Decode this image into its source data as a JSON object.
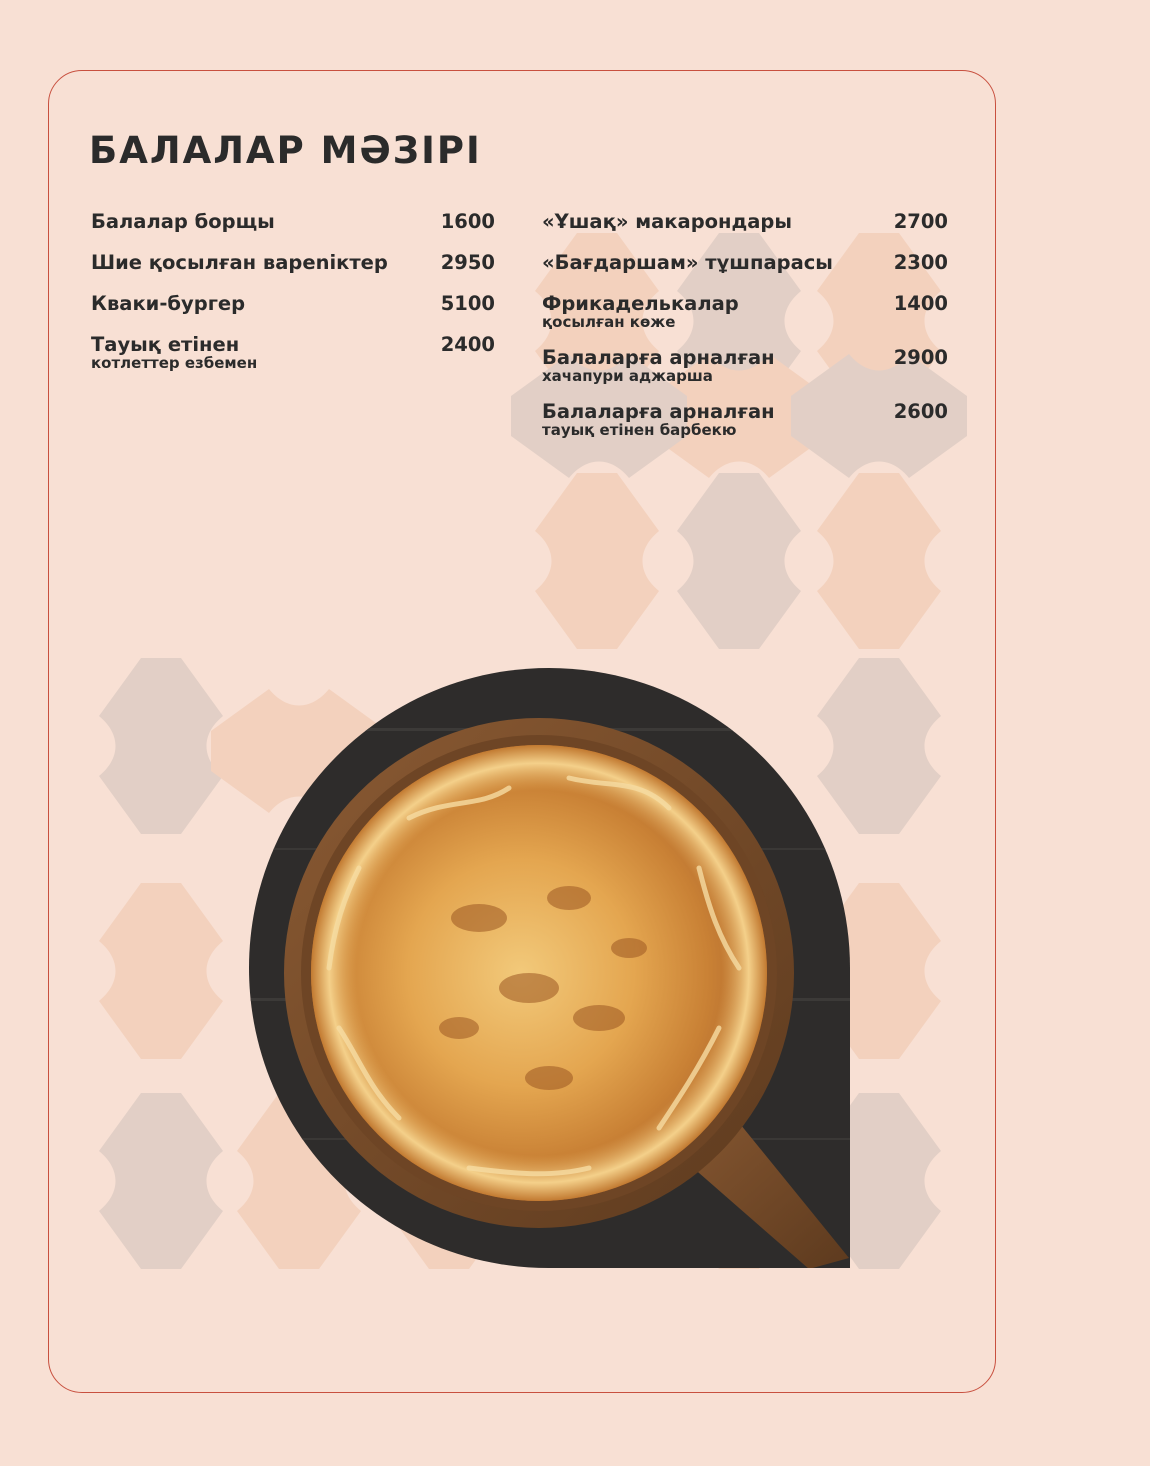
{
  "menu": {
    "title": "БАЛАЛАР МӘЗІРІ",
    "left_items": [
      {
        "name": "Балалар борщы",
        "sub": "",
        "price": "1600"
      },
      {
        "name": "Шие қосылған вареniктер",
        "sub": "",
        "price": "2950"
      },
      {
        "name": "Кваки-бургер",
        "sub": "",
        "price": "5100"
      },
      {
        "name": "Тауық етінен",
        "sub": "котлеттер езбемен",
        "price": "2400"
      }
    ],
    "right_items": [
      {
        "name": "«Ұшақ» макарондары",
        "sub": "",
        "price": "2700"
      },
      {
        "name": "«Бағдаршам» тұшпарасы",
        "sub": "",
        "price": "2300"
      },
      {
        "name": "Фрикаделькалар",
        "sub": "қосылған көже",
        "price": "1400"
      },
      {
        "name": "Балаларға арналған",
        "sub": "хачапури аджарша",
        "price": "2900"
      },
      {
        "name": "Балаларға арналған",
        "sub": "тауық етінен барбекю",
        "price": "2600"
      }
    ]
  },
  "colors": {
    "background": "#f8e0d4",
    "border": "#c8503f",
    "text": "#2b2b2b",
    "pattern_beige": "#f3d1bd",
    "pattern_grey": "#e2cfc6"
  },
  "image": {
    "icon": "khachapuri-photo"
  }
}
